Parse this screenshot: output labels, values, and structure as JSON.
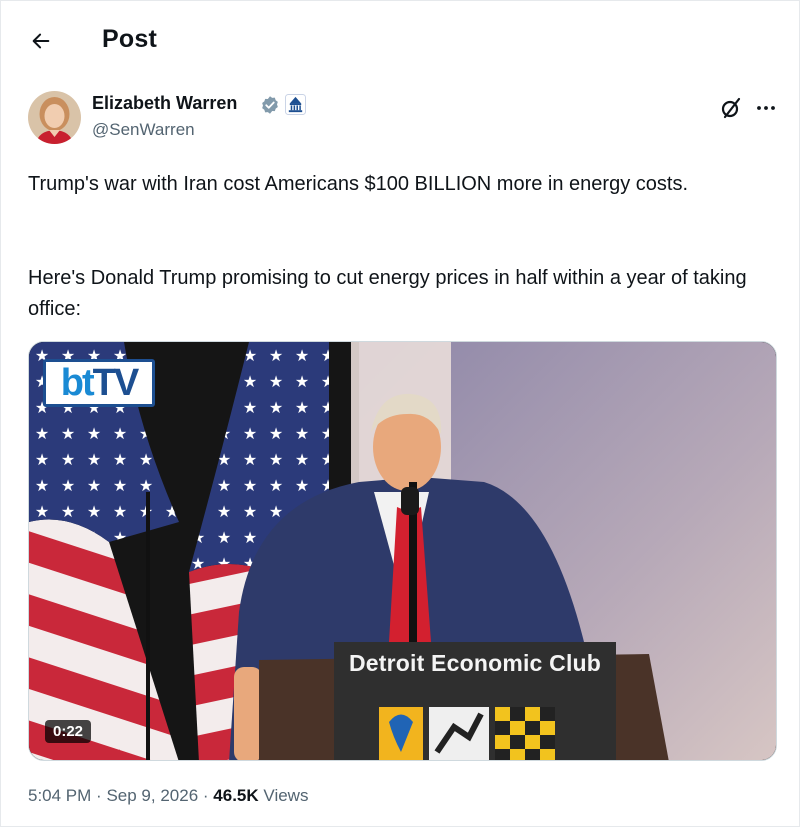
{
  "header": {
    "title": "Post"
  },
  "author": {
    "name": "Elizabeth Warren",
    "handle": "@SenWarren"
  },
  "post": {
    "paragraphs": [
      "Trump's war with Iran cost Americans $100 BILLION more in energy costs.",
      "Here's Donald Trump promising to cut energy prices in half within a year of taking office:"
    ]
  },
  "media": {
    "logo_bt": "bt",
    "logo_tv": "TV",
    "podium_text": "Detroit Economic Club",
    "duration": "0:22"
  },
  "meta": {
    "time": "5:04 PM",
    "separator": "·",
    "date": "Sep 9, 2026",
    "views_count": "46.5K",
    "views_label": "Views"
  },
  "colors": {
    "text_primary": "#0f1419",
    "text_secondary": "#536471",
    "verified_badge": "#829aab",
    "affiliation_badge": "#1d4f91"
  },
  "icons": {
    "back": "arrow-left-icon",
    "verified": "verified-badge-icon",
    "affiliation": "capitol-affiliation-icon",
    "grok": "grok-icon",
    "more": "more-horizontal-icon"
  }
}
